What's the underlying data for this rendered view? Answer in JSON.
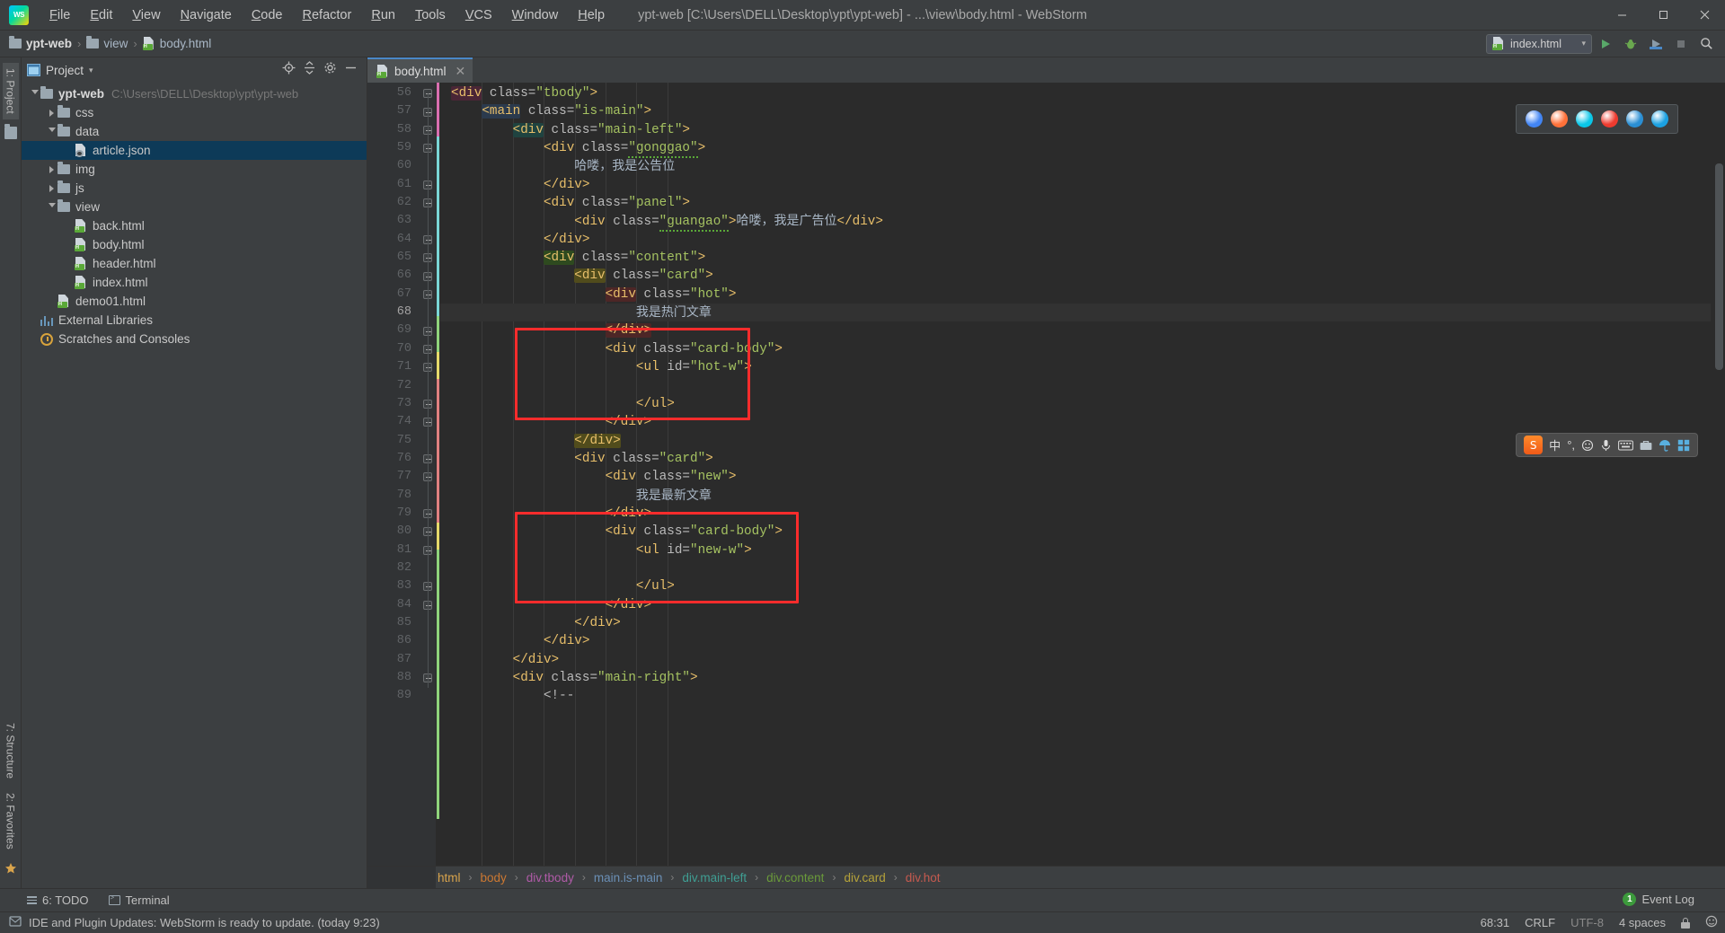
{
  "window": {
    "title": "ypt-web [C:\\Users\\DELL\\Desktop\\ypt\\ypt-web] - ...\\view\\body.html - WebStorm",
    "logo_text": "WS",
    "minimize": "—",
    "maximize": "❐",
    "close": "✕"
  },
  "menu": [
    {
      "label": "File"
    },
    {
      "label": "Edit"
    },
    {
      "label": "View"
    },
    {
      "label": "Navigate"
    },
    {
      "label": "Code"
    },
    {
      "label": "Refactor"
    },
    {
      "label": "Run"
    },
    {
      "label": "Tools"
    },
    {
      "label": "VCS"
    },
    {
      "label": "Window"
    },
    {
      "label": "Help"
    }
  ],
  "navbar": {
    "crumbs": [
      {
        "label": "ypt-web",
        "icon": "folder-icon",
        "bold": true
      },
      {
        "label": "view",
        "icon": "folder-icon",
        "bold": false
      },
      {
        "label": "body.html",
        "icon": "html-file-icon",
        "bold": false
      }
    ],
    "separator": "›",
    "run_config": "index.html",
    "chevron": "▾"
  },
  "rail": {
    "left_top": "1: Project",
    "left_bottom_1": "7: Structure",
    "left_bottom_2": "2: Favorites"
  },
  "project_panel": {
    "title": "Project",
    "chevron": "▾",
    "tree": [
      {
        "label": "ypt-web",
        "sub": "C:\\Users\\DELL\\Desktop\\ypt\\ypt-web",
        "depth": 0,
        "type": "folder",
        "state": "open",
        "bold": true,
        "selected": false
      },
      {
        "label": "css",
        "sub": "",
        "depth": 1,
        "type": "folder",
        "state": "closed",
        "bold": false,
        "selected": false
      },
      {
        "label": "data",
        "sub": "",
        "depth": 1,
        "type": "folder",
        "state": "open",
        "bold": false,
        "selected": false
      },
      {
        "label": "article.json",
        "sub": "",
        "depth": 2,
        "type": "json",
        "state": "leaf",
        "bold": false,
        "selected": true
      },
      {
        "label": "img",
        "sub": "",
        "depth": 1,
        "type": "folder",
        "state": "closed",
        "bold": false,
        "selected": false
      },
      {
        "label": "js",
        "sub": "",
        "depth": 1,
        "type": "folder",
        "state": "closed",
        "bold": false,
        "selected": false
      },
      {
        "label": "view",
        "sub": "",
        "depth": 1,
        "type": "folder",
        "state": "open",
        "bold": false,
        "selected": false
      },
      {
        "label": "back.html",
        "sub": "",
        "depth": 2,
        "type": "html",
        "state": "leaf",
        "bold": false,
        "selected": false
      },
      {
        "label": "body.html",
        "sub": "",
        "depth": 2,
        "type": "html",
        "state": "leaf",
        "bold": false,
        "selected": false
      },
      {
        "label": "header.html",
        "sub": "",
        "depth": 2,
        "type": "html",
        "state": "leaf",
        "bold": false,
        "selected": false
      },
      {
        "label": "index.html",
        "sub": "",
        "depth": 2,
        "type": "html",
        "state": "leaf",
        "bold": false,
        "selected": false
      },
      {
        "label": "demo01.html",
        "sub": "",
        "depth": 1,
        "type": "html",
        "state": "leaf",
        "bold": false,
        "selected": false
      },
      {
        "label": "External Libraries",
        "sub": "",
        "depth": 0,
        "type": "library",
        "state": "leaf",
        "bold": false,
        "selected": false
      },
      {
        "label": "Scratches and Consoles",
        "sub": "",
        "depth": 0,
        "type": "scratch",
        "state": "leaf",
        "bold": false,
        "selected": false
      }
    ]
  },
  "editor": {
    "tab": {
      "label": "body.html",
      "close": "✕"
    },
    "first_line": 56,
    "cursor_line": 68,
    "lines": [
      {
        "n": 56,
        "indent": 0,
        "html": "<span class='tag hl-plum'>&lt;div</span><span class='attr'> class=</span><span class='val'>\"tbody\"</span><span class='tag'>&gt;</span>"
      },
      {
        "n": 57,
        "indent": 1,
        "html": "<span class='tag hl-blue'>&lt;main</span><span class='attr'> class=</span><span class='val'>\"is-main\"</span><span class='tag'>&gt;</span>"
      },
      {
        "n": 58,
        "indent": 2,
        "html": "<span class='tag hl-teal'>&lt;div</span><span class='attr'> class=</span><span class='val'>\"main-left\"</span><span class='tag'>&gt;</span>"
      },
      {
        "n": 59,
        "indent": 3,
        "html": "<span class='tag'>&lt;div</span><span class='attr'> class=</span><span class='val wavy'>\"gonggao\"</span><span class='tag'>&gt;</span>"
      },
      {
        "n": 60,
        "indent": 4,
        "html": "<span class='txt cjk'>哈喽，我是公告位</span>"
      },
      {
        "n": 61,
        "indent": 3,
        "html": "<span class='tag'>&lt;/div&gt;</span>"
      },
      {
        "n": 62,
        "indent": 3,
        "html": "<span class='tag'>&lt;div</span><span class='attr'> class=</span><span class='val'>\"panel\"</span><span class='tag'>&gt;</span>"
      },
      {
        "n": 63,
        "indent": 4,
        "html": "<span class='tag'>&lt;div</span><span class='attr'> class=</span><span class='val wavy'>\"guangao\"</span><span class='tag'>&gt;</span><span class='txt cjk'>哈喽，我是广告位</span><span class='tag'>&lt;/div&gt;</span>"
      },
      {
        "n": 64,
        "indent": 3,
        "html": "<span class='tag'>&lt;/div&gt;</span>"
      },
      {
        "n": 65,
        "indent": 3,
        "html": "<span class='tag hl-green'>&lt;div</span><span class='attr'> class=</span><span class='val'>\"content\"</span><span class='tag'>&gt;</span>"
      },
      {
        "n": 66,
        "indent": 4,
        "html": "<span class='tag hl-yellow'>&lt;div</span><span class='attr'> class=</span><span class='val'>\"card\"</span><span class='tag'>&gt;</span>"
      },
      {
        "n": 67,
        "indent": 5,
        "html": "<span class='tag hl-red'>&lt;div</span><span class='attr'> class=</span><span class='val'>\"hot\"</span><span class='tag'>&gt;</span>"
      },
      {
        "n": 68,
        "indent": 6,
        "html": "<span class='txt cjk'>我是热门文章</span>"
      },
      {
        "n": 69,
        "indent": 5,
        "html": "<span class='tag hl-red'>&lt;/div&gt;</span>"
      },
      {
        "n": 70,
        "indent": 5,
        "html": "<span class='tag'>&lt;div</span><span class='attr'> class=</span><span class='val'>\"card-body\"</span><span class='tag'>&gt;</span>"
      },
      {
        "n": 71,
        "indent": 6,
        "html": "<span class='tag'>&lt;ul</span><span class='attr'> id=</span><span class='val'>\"hot-w\"</span><span class='tag'>&gt;</span>"
      },
      {
        "n": 72,
        "indent": 0,
        "html": ""
      },
      {
        "n": 73,
        "indent": 6,
        "html": "<span class='tag'>&lt;/ul&gt;</span>"
      },
      {
        "n": 74,
        "indent": 5,
        "html": "<span class='tag'>&lt;/div&gt;</span>"
      },
      {
        "n": 75,
        "indent": 4,
        "html": "<span class='tag hl-yellow'>&lt;/div&gt;</span>"
      },
      {
        "n": 76,
        "indent": 4,
        "html": "<span class='tag'>&lt;div</span><span class='attr'> class=</span><span class='val'>\"card\"</span><span class='tag'>&gt;</span>"
      },
      {
        "n": 77,
        "indent": 5,
        "html": "<span class='tag'>&lt;div</span><span class='attr'> class=</span><span class='val'>\"new\"</span><span class='tag'>&gt;</span>"
      },
      {
        "n": 78,
        "indent": 6,
        "html": "<span class='txt cjk'>我是最新文章</span>"
      },
      {
        "n": 79,
        "indent": 5,
        "html": "<span class='tag'>&lt;/div&gt;</span>"
      },
      {
        "n": 80,
        "indent": 5,
        "html": "<span class='tag'>&lt;div</span><span class='attr'> class=</span><span class='val'>\"card-body\"</span><span class='tag'>&gt;</span>"
      },
      {
        "n": 81,
        "indent": 6,
        "html": "<span class='tag'>&lt;ul</span><span class='attr'> id=</span><span class='val'>\"new-w\"</span><span class='tag'>&gt;</span>"
      },
      {
        "n": 82,
        "indent": 0,
        "html": ""
      },
      {
        "n": 83,
        "indent": 6,
        "html": "<span class='tag'>&lt;/ul&gt;</span>"
      },
      {
        "n": 84,
        "indent": 5,
        "html": "<span class='tag'>&lt;/div&gt;</span>"
      },
      {
        "n": 85,
        "indent": 4,
        "html": "<span class='tag'>&lt;/div&gt;</span>"
      },
      {
        "n": 86,
        "indent": 3,
        "html": "<span class='tag'>&lt;/div&gt;</span>"
      },
      {
        "n": 87,
        "indent": 2,
        "html": "<span class='tag'>&lt;/div&gt;</span>"
      },
      {
        "n": 88,
        "indent": 2,
        "html": "<span class='tag'>&lt;div</span><span class='attr'> class=</span><span class='val'>\"main-right\"</span><span class='tag'>&gt;</span>"
      },
      {
        "n": 89,
        "indent": 3,
        "html": "<span class='cmt'>&lt;!--</span>"
      }
    ]
  },
  "breadcrumb": {
    "separator": "›",
    "items": [
      {
        "label": "html",
        "color": "#d9a44c"
      },
      {
        "label": "body",
        "color": "#cc7832"
      },
      {
        "label": "div.tbody",
        "color": "#b05ba8"
      },
      {
        "label": "main.is-main",
        "color": "#6a8fb5"
      },
      {
        "label": "div.main-left",
        "color": "#3f9e93"
      },
      {
        "label": "div.content",
        "color": "#6a9a3a"
      },
      {
        "label": "div.card",
        "color": "#b5a23a"
      },
      {
        "label": "div.hot",
        "color": "#c55a4f"
      }
    ]
  },
  "bottom_bar": {
    "todo": "6: TODO",
    "terminal": "Terminal"
  },
  "status_bar": {
    "message": "IDE and Plugin Updates: WebStorm is ready to update. (today 9:23)",
    "caret": "68:31",
    "line_separator": "CRLF",
    "encoding": "UTF-8",
    "indent": "4 spaces",
    "event_log": "Event Log",
    "event_count": "1"
  },
  "overlays": {
    "browser_popup": {
      "icons": [
        "chrome-icon",
        "firefox-icon",
        "edge-legacy-icon",
        "opera-icon",
        "edge-icon",
        "ie-icon"
      ],
      "colors": [
        "#4285f4",
        "#ff7139",
        "#0ac7e8",
        "#ee3b2f",
        "#2a8fd4",
        "#1ba1e2"
      ]
    },
    "ime_bar": {
      "logo": "S",
      "items": [
        "中",
        "°,",
        "smiley-icon",
        "mic-icon",
        "keyboard-icon",
        "toolbox-icon",
        "umbrella-icon",
        "grid-icon"
      ]
    }
  },
  "colors": {
    "accent": "#4a88c7",
    "annotation_red": "#fb2c2c",
    "selection_blue": "#0d3a58",
    "editor_bg": "#2b2b2b",
    "panel_bg": "#3c3f41"
  }
}
